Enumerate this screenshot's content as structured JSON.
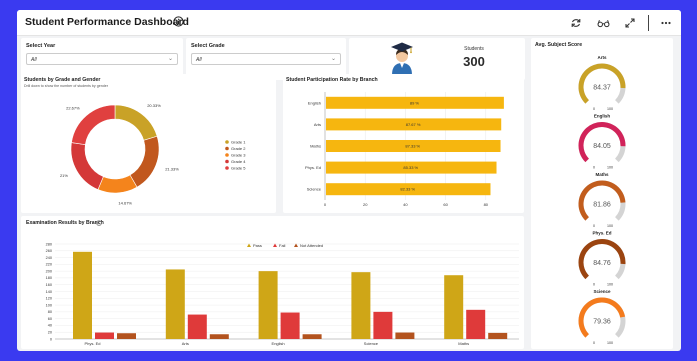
{
  "header": {
    "title": "Student Performance Dashboard"
  },
  "filters": {
    "year_label": "Select Year",
    "year_value": "All",
    "grade_label": "Select Grade",
    "grade_value": "All"
  },
  "kpi": {
    "label": "Students",
    "value": "300"
  },
  "gender_chart": {
    "title": "Students by Grade and Gender",
    "subtitle": "Drill down to show the number of students by gender"
  },
  "participation_chart": {
    "title": "Student Participation Rate by Branch"
  },
  "exam_chart": {
    "title": "Examination Results by Branch"
  },
  "subject_scores": {
    "title": "Avg. Subject Score",
    "min_label": "0",
    "max_label": "100"
  },
  "chart_data": [
    {
      "type": "pie",
      "title": "Students by Grade and Gender",
      "subtitle": "Drill down to show the number of students by gender",
      "categories": [
        "Grade 1",
        "Grade 2",
        "Grade 3",
        "Grade 4",
        "Grade 5"
      ],
      "values": [
        20.33,
        21.33,
        14.67,
        21,
        22.67
      ],
      "labels": [
        "20.33%",
        "21.33%",
        "14.67%",
        "21%",
        "22.67%"
      ],
      "colors": [
        "#c9a227",
        "#c1581e",
        "#f4841c",
        "#d43838",
        "#e0403f"
      ],
      "legend": "right"
    },
    {
      "type": "bar",
      "orientation": "horizontal",
      "title": "Student Participation Rate by Branch",
      "categories": [
        "English",
        "Arts",
        "Maths",
        "Phys. Ed",
        "Science"
      ],
      "values": [
        89,
        87.67,
        87.33,
        85.33,
        82.33
      ],
      "labels": [
        "89 %",
        "87.67 %",
        "87.33 %",
        "85.33 %",
        "82.33 %"
      ],
      "xlim": [
        0,
        100
      ],
      "xticks": [
        "0",
        "20",
        "40",
        "60",
        "80",
        "100"
      ],
      "color": "#f6b60f"
    },
    {
      "type": "bar",
      "title": "Examination Results by Branch",
      "categories": [
        "Phys. Ed",
        "Arts",
        "English",
        "Science",
        "Maths"
      ],
      "series": [
        {
          "name": "Pass",
          "values": [
            257,
            205,
            200,
            197,
            188
          ],
          "color": "#cfa617"
        },
        {
          "name": "Fail",
          "values": [
            19,
            72,
            78,
            80,
            86
          ],
          "color": "#df3a3a"
        },
        {
          "name": "Not Attended",
          "values": [
            17,
            14,
            14,
            19,
            18
          ],
          "color": "#b3531e"
        }
      ],
      "ylim": [
        0,
        280
      ],
      "yticks": [
        "0",
        "20",
        "40",
        "60",
        "80",
        "100",
        "120",
        "140",
        "160",
        "180",
        "200",
        "220",
        "240",
        "260",
        "280"
      ],
      "legend": "top-center"
    },
    {
      "type": "gauge",
      "title": "Avg. Subject Score",
      "range": [
        0,
        100
      ],
      "items": [
        {
          "name": "Arts",
          "value": 84.37,
          "label": "84.37",
          "color": "#c9a227"
        },
        {
          "name": "English",
          "value": 84.05,
          "label": "84.05",
          "color": "#d1235a"
        },
        {
          "name": "Maths",
          "value": 81.86,
          "label": "81.86",
          "color": "#c25d1d"
        },
        {
          "name": "Phys. Ed",
          "value": 84.76,
          "label": "84.76",
          "color": "#9b4410"
        },
        {
          "name": "Science",
          "value": 79.36,
          "label": "79.36",
          "color": "#f47b1d"
        }
      ]
    }
  ],
  "icons": [
    "info-icon",
    "refresh-icon",
    "glasses-icon",
    "expand-icon",
    "more-icon",
    "graduate-icon",
    "chevron-down-icon"
  ]
}
